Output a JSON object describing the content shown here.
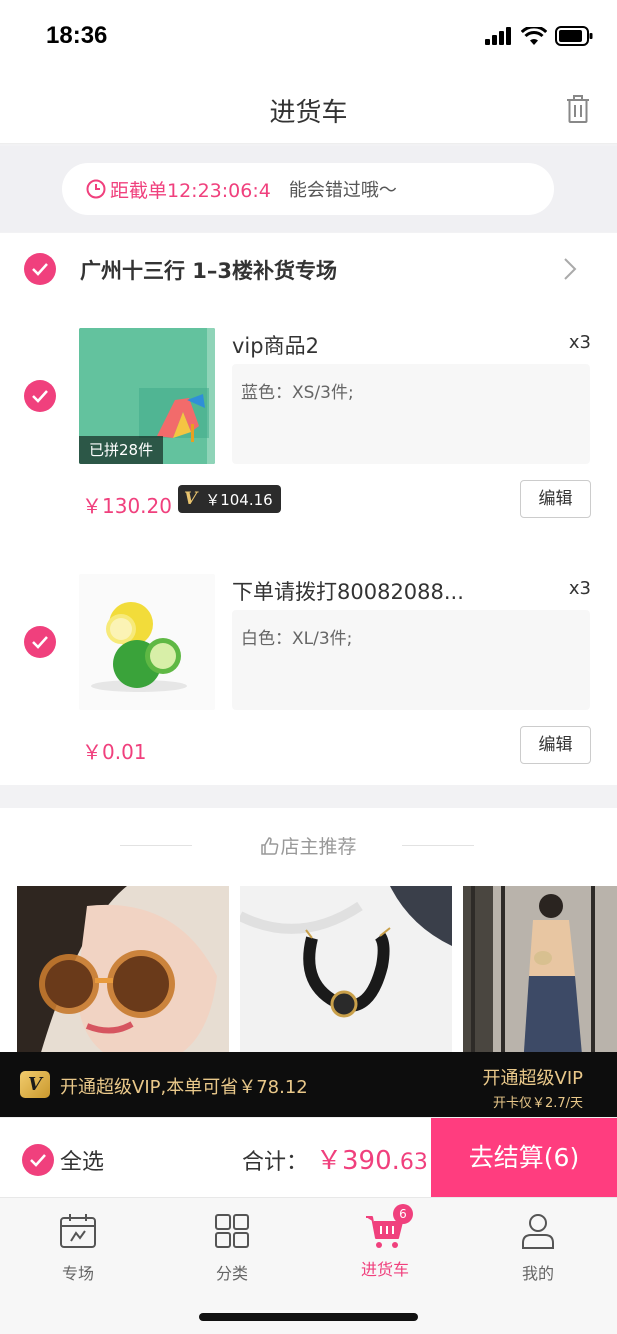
{
  "status_bar": {
    "time": "18:36"
  },
  "nav": {
    "title": "进货车",
    "trash_icon": "trash-icon"
  },
  "countdown": {
    "text": "距截单12:23:06:4",
    "note": "能会错过哦～"
  },
  "shop": {
    "name": "广州十三行 1–3楼补货专场"
  },
  "items": [
    {
      "name": "vip商品2",
      "qty": "x3",
      "spec": "蓝色：XS/3件;",
      "badge": "已拼28件",
      "price": "￥130.20",
      "vip_price": "￥104.16",
      "edit_label": "编辑"
    },
    {
      "name": "下单请拨打80082088...",
      "qty": "x3",
      "spec": "白色：XL/3件;",
      "price": "￥0.01",
      "edit_label": "编辑"
    }
  ],
  "recommend": {
    "title": "店主推荐"
  },
  "vip_banner": {
    "text": "开通超级VIP,本单可省￥78.12",
    "open_label": "开通超级VIP",
    "sub": "开卡仅￥2.7/天"
  },
  "checkout": {
    "select_all": "全选",
    "total_label": "合计：",
    "total_int": "￥390.",
    "total_dec": "63",
    "button": "去结算(6)"
  },
  "tabs": [
    {
      "label": "专场",
      "icon": "calendar-icon"
    },
    {
      "label": "分类",
      "icon": "grid-icon"
    },
    {
      "label": "进货车",
      "icon": "cart-icon",
      "badge": "6",
      "active": true
    },
    {
      "label": "我的",
      "icon": "person-icon"
    }
  ],
  "colors": {
    "accent": "#f0407d",
    "checkout_button": "#ff3d7f",
    "vip_gold": "#e9c88a"
  }
}
